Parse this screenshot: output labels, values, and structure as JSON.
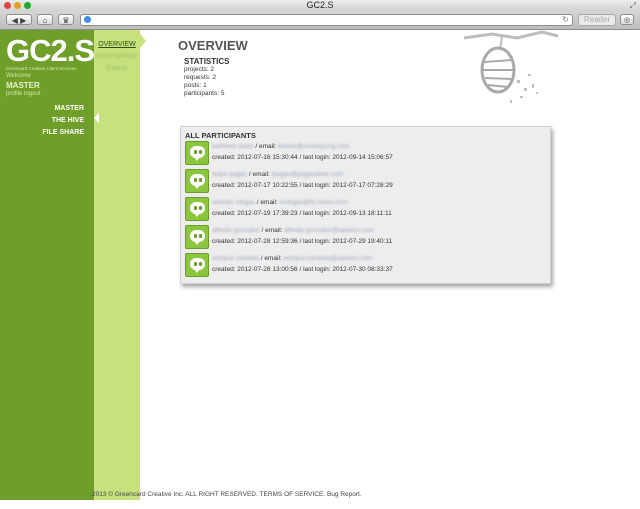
{
  "window": {
    "title": "GC2.S",
    "reader_label": "Reader"
  },
  "sidebar": {
    "logo": "GC2.S",
    "logo_tagline": "Greencard Creative Client Services",
    "welcome": "Welcome",
    "user": "MASTER",
    "profile_link": "profile",
    "logout_link": "logout",
    "nav": [
      {
        "label": "MASTER"
      },
      {
        "label": "THE HIVE"
      },
      {
        "label": "FILE SHARE"
      }
    ],
    "subnav": [
      {
        "label": "OVERVIEW"
      },
      {
        "label": "ExternalFlow"
      },
      {
        "label": "Clients"
      }
    ]
  },
  "main": {
    "title": "OVERVIEW",
    "statistics": {
      "heading": "STATISTICS",
      "projects": "projects: 2",
      "requests": "requests: 2",
      "posts": "posts: 1",
      "participants": "participants: 5"
    },
    "participants": {
      "heading": "ALL PARTICIPANTS",
      "email_sep": " / email: ",
      "rows": [
        {
          "name": "kathleen davis",
          "email": "kdavis@creamyung.com",
          "details": "created: 2012-07-16 15:30:44 / last login: 2012-09-14 15:06:57"
        },
        {
          "name": "felipe pages",
          "email": "fpages@pagesdesk.com",
          "details": "created: 2012-07-17 10:22:55 / last login: 2012-07-17 07:28:29"
        },
        {
          "name": "orlando vargas",
          "email": "ovargas@fix.move.com",
          "details": "created: 2012-07-19 17:39:23 / last login: 2012-09-13 18:11:11"
        },
        {
          "name": "alfredo gonzalez",
          "email": "alfredo.gonzalez@aaseco.com",
          "details": "created: 2012-07-28 12:59:36 / last login: 2012-07-29 19:40:11"
        },
        {
          "name": "enrique cordoba",
          "email": "enrique.cordoba@aaseco.com",
          "details": "created: 2012-07-28 13:00:56 / last login: 2012-07-30 08:33:37"
        }
      ]
    }
  },
  "footer": {
    "copyright": "2013 © Greencard Creative Inc. ALL RIGHT RESERVED.",
    "terms": "TERMS OF SERVICE.",
    "bug": "Bug Report."
  },
  "colors": {
    "sidebar_dark": "#6f9f2a",
    "sidebar_light": "#c7e17d",
    "avatar": "#8cc63f"
  }
}
